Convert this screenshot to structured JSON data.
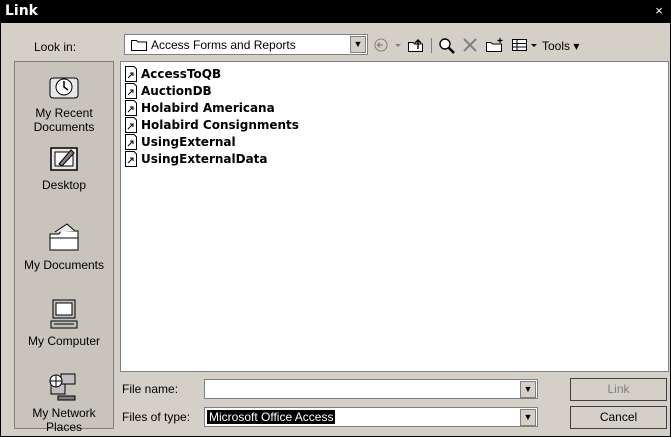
{
  "window": {
    "title": "Link",
    "close_glyph": "×"
  },
  "look_in": {
    "label": "Look in:",
    "value": "Access Forms and Reports"
  },
  "toolbar": {
    "tools_label": "Tools"
  },
  "places": [
    {
      "label": "My Recent Documents",
      "icon": "recent-documents-icon"
    },
    {
      "label": "Desktop",
      "icon": "desktop-icon"
    },
    {
      "label": "My Documents",
      "icon": "my-documents-icon"
    },
    {
      "label": "My Computer",
      "icon": "my-computer-icon"
    },
    {
      "label": "My Network Places",
      "icon": "network-places-icon"
    }
  ],
  "files": [
    {
      "name": "AccessToQB"
    },
    {
      "name": "AuctionDB"
    },
    {
      "name": "Holabird Americana"
    },
    {
      "name": "Holabird Consignments"
    },
    {
      "name": "UsingExternal"
    },
    {
      "name": "UsingExternalData"
    }
  ],
  "file_name": {
    "label": "File name:",
    "value": ""
  },
  "files_of_type": {
    "label": "Files of type:",
    "value": "Microsoft Office Access"
  },
  "buttons": {
    "link": "Link",
    "cancel": "Cancel"
  }
}
